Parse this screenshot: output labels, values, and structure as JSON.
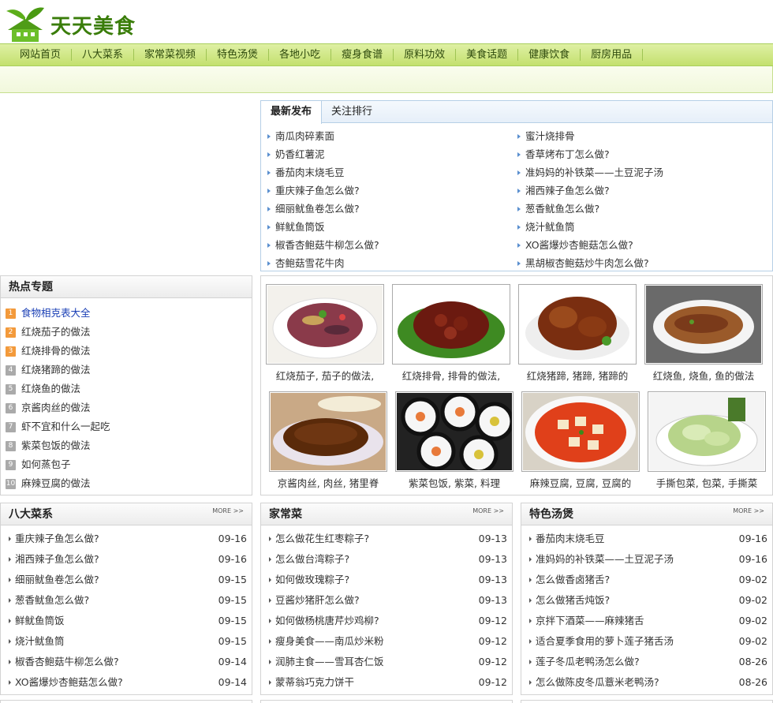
{
  "site": {
    "name": "天天美食"
  },
  "nav": [
    "网站首页",
    "八大菜系",
    "家常菜视频",
    "特色汤煲",
    "各地小吃",
    "瘦身食谱",
    "原料功效",
    "美食话题",
    "健康饮食",
    "厨房用品"
  ],
  "tabs": [
    "最新发布",
    "关注排行"
  ],
  "latest": [
    "南瓜肉碎素面",
    "蜜汁烧排骨",
    "奶香红薯泥",
    "香草烤布丁怎么做?",
    "番茄肉末烧毛豆",
    "准妈妈的补铁菜——土豆泥子汤",
    "重庆辣子鱼怎么做?",
    "湘西辣子鱼怎么做?",
    "细丽鱿鱼卷怎么做?",
    "葱香鱿鱼怎么做?",
    "鲜鱿鱼筒饭",
    "烧汁鱿鱼筒",
    "椒香杏鲍菇牛柳怎么做?",
    "XO酱爆炒杏鲍菇怎么做?",
    "杏鲍菇雪花牛肉",
    "黑胡椒杏鲍菇炒牛肉怎么做?"
  ],
  "hot": {
    "title": "热点专题",
    "items": [
      "食物相克表大全",
      "红烧茄子的做法",
      "红烧排骨的做法",
      "红烧猪蹄的做法",
      "红烧鱼的做法",
      "京酱肉丝的做法",
      "虾不宜和什么一起吃",
      "紫菜包饭的做法",
      "如何蒸包子",
      "麻辣豆腐的做法"
    ],
    "ranks": [
      "1",
      "2",
      "3",
      "4",
      "5",
      "6",
      "7",
      "8",
      "9",
      "10"
    ]
  },
  "photos": [
    "红烧茄子, 茄子的做法,",
    "红烧排骨, 排骨的做法,",
    "红烧猪蹄, 猪蹄, 猪蹄的",
    "红烧鱼, 烧鱼, 鱼的做法",
    "京酱肉丝, 肉丝, 猪里脊",
    "紫菜包饭, 紫菜, 料理",
    "麻辣豆腐, 豆腐, 豆腐的",
    "手撕包菜, 包菜, 手撕菜"
  ],
  "more": "MORE >>",
  "boxes": [
    {
      "title": "八大菜系",
      "items": [
        [
          "重庆辣子鱼怎么做?",
          "09-16"
        ],
        [
          "湘西辣子鱼怎么做?",
          "09-16"
        ],
        [
          "细丽鱿鱼卷怎么做?",
          "09-15"
        ],
        [
          "葱香鱿鱼怎么做?",
          "09-15"
        ],
        [
          "鲜鱿鱼筒饭",
          "09-15"
        ],
        [
          "烧汁鱿鱼筒",
          "09-15"
        ],
        [
          "椒香杏鲍菇牛柳怎么做?",
          "09-14"
        ],
        [
          "XO酱爆炒杏鲍菇怎么做?",
          "09-14"
        ]
      ]
    },
    {
      "title": "家常菜",
      "items": [
        [
          "怎么做花生红枣粽子?",
          "09-13"
        ],
        [
          "怎么做台湾粽子?",
          "09-13"
        ],
        [
          "如何做玫瑰粽子?",
          "09-13"
        ],
        [
          "豆酱炒猪肝怎么做?",
          "09-13"
        ],
        [
          "如何做杨桃唐芹炒鸡柳?",
          "09-12"
        ],
        [
          "瘦身美食——南瓜炒米粉",
          "09-12"
        ],
        [
          "润肺主食——雪耳杏仁饭",
          "09-12"
        ],
        [
          "蒙蒂翁巧克力饼干",
          "09-12"
        ]
      ]
    },
    {
      "title": "特色汤煲",
      "items": [
        [
          "番茄肉末烧毛豆",
          "09-16"
        ],
        [
          "准妈妈的补铁菜——土豆泥子汤",
          "09-16"
        ],
        [
          "怎么做香卤猪舌?",
          "09-02"
        ],
        [
          "怎么做猪舌炖饭?",
          "09-02"
        ],
        [
          "京拌下酒菜——麻辣猪舌",
          "09-02"
        ],
        [
          "适合夏季食用的萝卜莲子猪舌汤",
          "09-02"
        ],
        [
          "莲子冬瓜老鸭汤怎么做?",
          "08-26"
        ],
        [
          "怎么做陈皮冬瓜薏米老鸭汤?",
          "08-26"
        ]
      ]
    }
  ]
}
